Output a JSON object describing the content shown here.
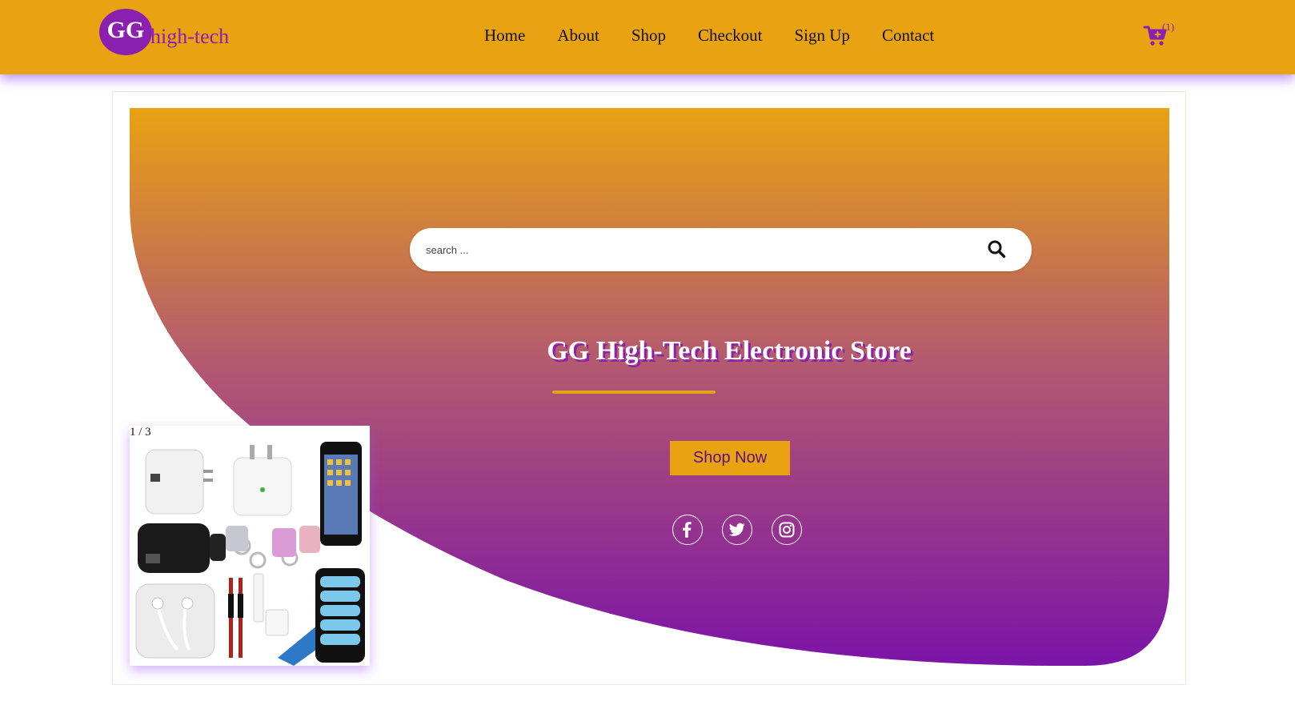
{
  "brand": {
    "logo_badge": "GG",
    "logo_text": "high-tech",
    "primary_color": "#e8a212",
    "accent_color": "#8a1fb0"
  },
  "nav": {
    "items": [
      {
        "label": "Home"
      },
      {
        "label": "About"
      },
      {
        "label": "Shop"
      },
      {
        "label": "Checkout"
      },
      {
        "label": "Sign Up"
      },
      {
        "label": "Contact"
      }
    ]
  },
  "cart": {
    "count_label": "(1)",
    "icon": "cart-icon"
  },
  "search": {
    "placeholder": "search ...",
    "icon": "search-icon"
  },
  "hero": {
    "title": "GG High-Tech Electronic Store",
    "cta_label": "Shop Now",
    "gradient_top": "#e8a212",
    "gradient_bottom": "#7b14a8",
    "social": [
      {
        "icon": "facebook-icon"
      },
      {
        "icon": "twitter-icon"
      },
      {
        "icon": "instagram-icon"
      }
    ]
  },
  "slider": {
    "counter": "1 / 3",
    "image": "phone-accessories-image"
  }
}
